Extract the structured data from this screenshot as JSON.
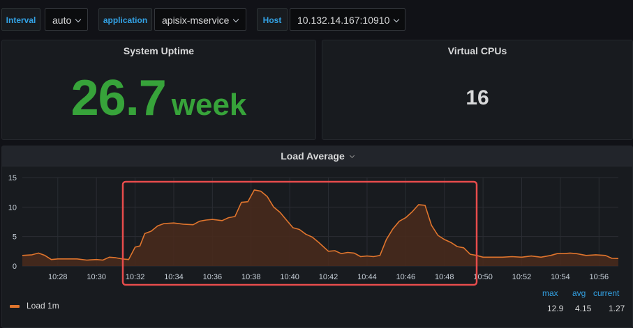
{
  "variables": [
    {
      "label": "Interval",
      "value": "auto"
    },
    {
      "label": "application",
      "value": "apisix-mservice"
    },
    {
      "label": "Host",
      "value": "10.132.14.167:10910"
    }
  ],
  "uptime_panel": {
    "title": "System Uptime",
    "value": "26.7",
    "unit": "week",
    "color": "#37a33a"
  },
  "vcpu_panel": {
    "title": "Virtual CPUs",
    "value": "16"
  },
  "load_panel": {
    "title": "Load Average",
    "legend": {
      "series_name": "Load 1m",
      "headers": {
        "max": "max",
        "avg": "avg",
        "current": "current"
      },
      "values": {
        "max": "12.9",
        "avg": "4.15",
        "current": "1.27"
      }
    }
  },
  "colors": {
    "series": "#e0752d",
    "fill": "#4a2a1c",
    "highlight": "#e74c4c",
    "accent": "#33a2e5"
  },
  "chart_data": {
    "type": "area",
    "ylim": [
      0,
      15
    ],
    "yticks": [
      0,
      5,
      10,
      15
    ],
    "xlim": [
      "10:26:10",
      "10:57:00"
    ],
    "xticks": [
      "10:28",
      "10:30",
      "10:32",
      "10:34",
      "10:36",
      "10:38",
      "10:40",
      "10:42",
      "10:44",
      "10:46",
      "10:48",
      "10:50",
      "10:52",
      "10:54",
      "10:56"
    ],
    "grid": true,
    "series": [
      {
        "name": "Load 1m",
        "x": [
          "10:26:10",
          "10:26:40",
          "10:27:00",
          "10:27:20",
          "10:27:40",
          "10:28:00",
          "10:28:30",
          "10:29:00",
          "10:29:30",
          "10:30:00",
          "10:30:20",
          "10:30:40",
          "10:31:00",
          "10:31:20",
          "10:31:40",
          "10:32:00",
          "10:32:15",
          "10:32:30",
          "10:32:50",
          "10:33:10",
          "10:33:30",
          "10:34:00",
          "10:34:30",
          "10:35:00",
          "10:35:20",
          "10:35:40",
          "10:36:00",
          "10:36:30",
          "10:36:50",
          "10:37:10",
          "10:37:30",
          "10:37:50",
          "10:38:10",
          "10:38:30",
          "10:38:50",
          "10:39:10",
          "10:39:30",
          "10:39:50",
          "10:40:10",
          "10:40:30",
          "10:40:50",
          "10:41:10",
          "10:41:30",
          "10:42:00",
          "10:42:20",
          "10:42:40",
          "10:43:00",
          "10:43:20",
          "10:43:40",
          "10:44:00",
          "10:44:20",
          "10:44:40",
          "10:45:00",
          "10:45:20",
          "10:45:40",
          "10:46:00",
          "10:46:20",
          "10:46:40",
          "10:47:00",
          "10:47:20",
          "10:47:40",
          "10:48:00",
          "10:48:20",
          "10:48:40",
          "10:49:00",
          "10:49:20",
          "10:49:40",
          "10:50:00",
          "10:50:30",
          "10:51:00",
          "10:51:30",
          "10:52:00",
          "10:52:30",
          "10:53:00",
          "10:53:30",
          "10:53:50",
          "10:54:10",
          "10:54:30",
          "10:54:50",
          "10:55:20",
          "10:55:50",
          "10:56:20",
          "10:56:40",
          "10:57:00"
        ],
        "y": [
          1.8,
          1.9,
          2.2,
          1.8,
          1.1,
          1.2,
          1.2,
          1.2,
          1.0,
          1.1,
          1.0,
          1.5,
          1.4,
          1.2,
          1.1,
          3.2,
          3.4,
          5.5,
          5.9,
          6.8,
          7.2,
          7.3,
          7.1,
          7.0,
          7.6,
          7.8,
          7.9,
          7.7,
          8.2,
          8.4,
          10.8,
          10.9,
          12.9,
          12.7,
          11.8,
          10.0,
          9.1,
          7.8,
          6.5,
          6.2,
          5.4,
          4.9,
          4.0,
          2.5,
          2.6,
          2.1,
          2.3,
          2.2,
          1.6,
          1.7,
          1.6,
          1.8,
          4.5,
          6.3,
          7.6,
          8.2,
          9.2,
          10.4,
          10.3,
          6.9,
          5.2,
          4.5,
          4.0,
          3.3,
          3.1,
          2.0,
          1.8,
          1.5,
          1.5,
          1.5,
          1.6,
          1.5,
          1.7,
          1.5,
          1.8,
          2.1,
          2.1,
          2.2,
          2.1,
          1.8,
          1.9,
          1.8,
          1.3,
          1.27
        ]
      }
    ]
  }
}
